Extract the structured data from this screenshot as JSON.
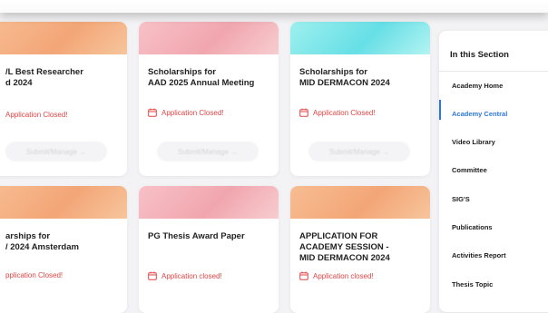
{
  "cards": [
    {
      "title": "/L Best Researcher\nd 2024",
      "status": "Application Closed!",
      "button": "Submit/Manage →"
    },
    {
      "title": "Scholarships for\nAAD 2025 Annual Meeting",
      "status": "Application Closed!",
      "button": "Submit/Manage →"
    },
    {
      "title": "Scholarships for\nMID DERMACON 2024",
      "status": "Application Closed!",
      "button": "Submit/Manage →"
    },
    {
      "title": "arships for\n/ 2024 Amsterdam",
      "status": "pplication Closed!"
    },
    {
      "title": "PG Thesis Award Paper",
      "status": "Application closed!"
    },
    {
      "title": "APPLICATION FOR\nACADEMY SESSION -\nMID DERMACON 2024",
      "status": "Application closed!"
    }
  ],
  "sidebar": {
    "title": "In this Section",
    "items": [
      {
        "label": "Academy Home"
      },
      {
        "label": "Academy Central"
      },
      {
        "label": "Video Library"
      },
      {
        "label": "Committee"
      },
      {
        "label": "SIG'S"
      },
      {
        "label": "Publications"
      },
      {
        "label": "Activities Report"
      },
      {
        "label": "Thesis Topic"
      }
    ]
  },
  "colors": {
    "accent": "#2e78d6",
    "status_closed": "#e04545"
  },
  "icons": {
    "status": "calendar-icon",
    "button": "arrow-right-icon"
  }
}
